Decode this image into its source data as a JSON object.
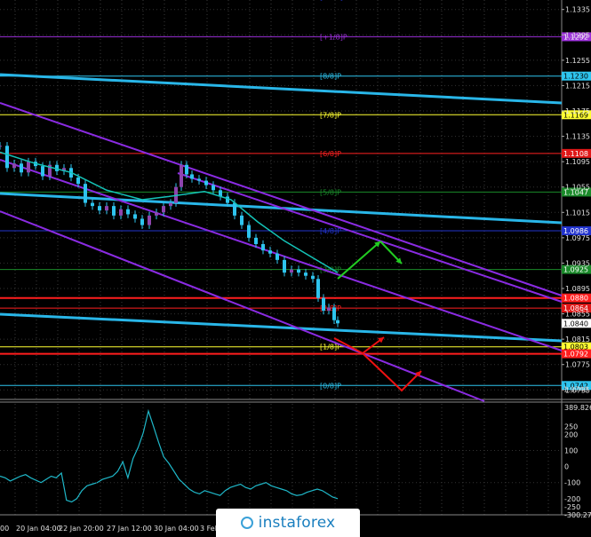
{
  "chart_data": [
    {
      "type": "line",
      "name": "price-panel",
      "ylim": [
        1.072,
        1.135
      ],
      "grid": true,
      "price_ticks": [
        "1.1335",
        "1.1295",
        "1.1255",
        "1.1215",
        "1.1175",
        "1.1135",
        "1.1095",
        "1.1055",
        "1.1015",
        "1.0975",
        "1.0935",
        "1.0895",
        "1.0855",
        "1.0815",
        "1.0775",
        "1.0735"
      ],
      "current_price": "1.0840",
      "levels": [
        {
          "label": "[+2/8]P",
          "price": 1.1355,
          "color": "#2233cc",
          "badge": ""
        },
        {
          "label": "[+1/8]P",
          "price": 1.1292,
          "color": "#9b30d9",
          "badge": "1.1292"
        },
        {
          "label": "[8/8]P",
          "price": 1.123,
          "color": "#2ec4ee",
          "badge": "1.1230"
        },
        {
          "label": "[7/8]P",
          "price": 1.1169,
          "color": "#ffff33",
          "badge": "1.1169"
        },
        {
          "label": "[6/8]P",
          "price": 1.1108,
          "color": "#ff2020",
          "badge": "1.1108"
        },
        {
          "label": "[5/8]P",
          "price": 1.1047,
          "color": "#1a8a2a",
          "badge": "1.1047"
        },
        {
          "label": "[4/8]P",
          "price": 1.0986,
          "color": "#2233cc",
          "badge": "1.0986"
        },
        {
          "label": "[3/8]P",
          "price": 1.0925,
          "color": "#1a8a2a",
          "badge": "1.0925"
        },
        {
          "label": "",
          "price": 1.088,
          "color": "#ff1e1e",
          "badge": "1.0880"
        },
        {
          "label": "[2/8]P",
          "price": 1.0864,
          "color": "#ff2020",
          "badge": "1.0864"
        },
        {
          "label": "[1/8]P",
          "price": 1.0803,
          "color": "#ffff33",
          "badge": "1.0803"
        },
        {
          "label": "",
          "price": 1.0792,
          "color": "#ff1e1e",
          "badge": "1.0792"
        },
        {
          "label": "[0/8]P",
          "price": 1.0742,
          "color": "#2ec4ee",
          "badge": "1.0742"
        }
      ],
      "extra_badge": "1.0740"
    },
    {
      "type": "line",
      "name": "oscillator-panel",
      "ylim": [
        -300.276,
        389.8265
      ],
      "ticks": [
        "389.8265",
        "250",
        "200",
        "100",
        "0",
        "-100",
        "-200",
        "-250",
        "-300.276"
      ],
      "osc_values": [
        -60,
        -70,
        -90,
        -75,
        -60,
        -50,
        -70,
        -85,
        -100,
        -80,
        -60,
        -70,
        -40,
        -210,
        -220,
        -200,
        -150,
        -120,
        -110,
        -100,
        -80,
        -70,
        -60,
        -30,
        30,
        -70,
        50,
        120,
        210,
        345,
        250,
        150,
        60,
        20,
        -30,
        -80,
        -110,
        -140,
        -160,
        -170,
        -150,
        -160,
        -170,
        -180,
        -150,
        -130,
        -120,
        -110,
        -130,
        -140,
        -120,
        -110,
        -100,
        -120,
        -130,
        -140,
        -150,
        -170,
        -180,
        -175,
        -160,
        -150,
        -140,
        -150,
        -170,
        -190,
        -200
      ]
    }
  ],
  "time_labels": [
    "20 Jan 04:00",
    "22 Jan 20:00",
    "27 Jan 12:00",
    "30 Jan 04:00",
    "3 Feb"
  ],
  "time_label_partial": "00",
  "logo": {
    "text": "instaforex"
  },
  "colors": {
    "accent_cyan": "#29b6e8",
    "bg": "#000000",
    "candle": "#2ec4ee",
    "ma": "#14c4b8"
  }
}
